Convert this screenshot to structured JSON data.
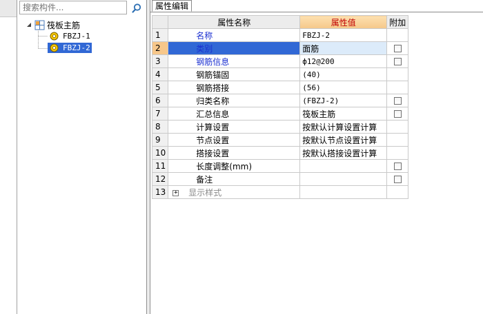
{
  "search": {
    "placeholder": "搜索构件..."
  },
  "tree": {
    "root_label": "筏板主筋",
    "children": [
      {
        "label": "FBZJ-1",
        "selected": false
      },
      {
        "label": "FBZJ-2",
        "selected": true
      }
    ]
  },
  "tabs": {
    "attr_edit": "属性编辑"
  },
  "grid": {
    "headers": {
      "name": "属性名称",
      "value": "属性值",
      "extra": "附加"
    },
    "rows": [
      {
        "num": "1",
        "name": "名称",
        "value": "FBZJ-2",
        "blue": true,
        "check": false
      },
      {
        "num": "2",
        "name": "类别",
        "value": "面筋",
        "blue": true,
        "check": true,
        "selected": true
      },
      {
        "num": "3",
        "name": "钢筋信息",
        "value": "ф12@200",
        "blue": true,
        "check": true
      },
      {
        "num": "4",
        "name": "钢筋锚固",
        "value": "(40)",
        "blue": false,
        "check": false
      },
      {
        "num": "5",
        "name": "钢筋搭接",
        "value": "(56)",
        "blue": false,
        "check": false
      },
      {
        "num": "6",
        "name": "归类名称",
        "value": "(FBZJ-2)",
        "blue": false,
        "check": true
      },
      {
        "num": "7",
        "name": "汇总信息",
        "value": "筏板主筋",
        "blue": false,
        "check": true
      },
      {
        "num": "8",
        "name": "计算设置",
        "value": "按默认计算设置计算",
        "blue": false,
        "check": false
      },
      {
        "num": "9",
        "name": "节点设置",
        "value": "按默认节点设置计算",
        "blue": false,
        "check": false
      },
      {
        "num": "10",
        "name": "搭接设置",
        "value": "按默认搭接设置计算",
        "blue": false,
        "check": false
      },
      {
        "num": "11",
        "name": "长度调整(mm)",
        "value": "",
        "blue": false,
        "check": true
      },
      {
        "num": "12",
        "name": "备注",
        "value": "",
        "blue": false,
        "check": true
      },
      {
        "num": "13",
        "name": "显示样式",
        "value": "",
        "blue": false,
        "check": false,
        "expandable": true,
        "expander": "+"
      }
    ]
  },
  "colors": {
    "selection": "#3168d5",
    "value_header_text": "#c00000",
    "link_text": "#1a2fd0"
  }
}
